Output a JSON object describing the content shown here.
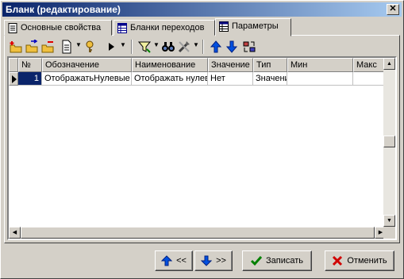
{
  "window": {
    "title": "Бланк (редактирование)",
    "close_glyph": "✕"
  },
  "tabs": [
    {
      "label": "Основные свойства",
      "icon": "document-icon"
    },
    {
      "label": "Бланки переходов",
      "icon": "table-icon"
    },
    {
      "label": "Параметры",
      "icon": "grid-icon",
      "active": true
    }
  ],
  "grid": {
    "columns": [
      "№",
      "Обозначение",
      "Наименование",
      "Значение",
      "Тип",
      "Мин",
      "Макс"
    ],
    "rows": [
      {
        "num": "1",
        "designation": "ОтображатьНулевые",
        "name": "Отображать нулев",
        "value": "Нет",
        "type": "Значени",
        "min": "",
        "max": ""
      }
    ]
  },
  "buttons": {
    "prev": "<<",
    "next": ">>",
    "save": "Записать",
    "cancel": "Отменить"
  },
  "colors": {
    "title_start": "#0a246a",
    "title_end": "#a6caf0",
    "selection": "#0a246a",
    "face": "#d4d0c8"
  }
}
